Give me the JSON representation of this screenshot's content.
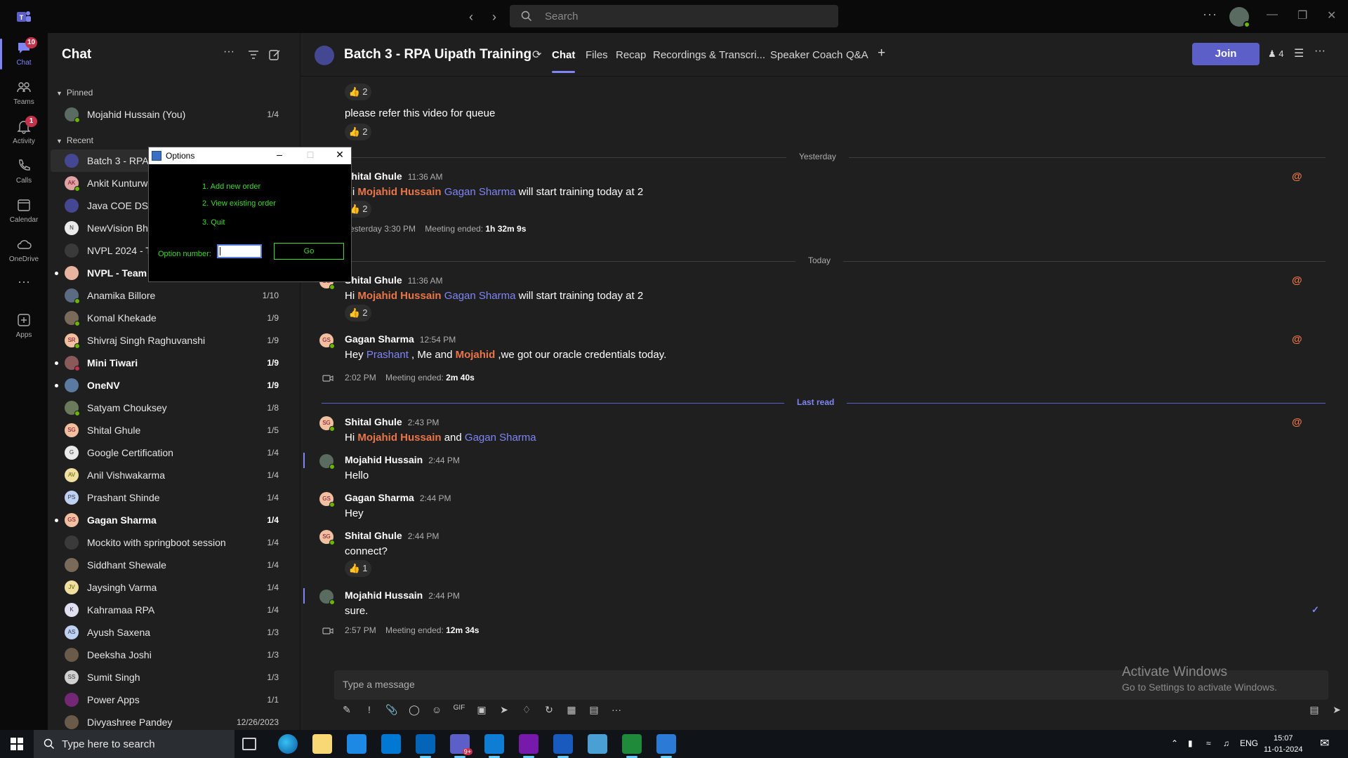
{
  "titlebar": {
    "search_placeholder": "Search"
  },
  "rail": {
    "items": [
      {
        "label": "Chat",
        "badge": "10"
      },
      {
        "label": "Teams"
      },
      {
        "label": "Activity",
        "badge": "1"
      },
      {
        "label": "Calls"
      },
      {
        "label": "Calendar"
      },
      {
        "label": "OneDrive"
      },
      {
        "label": "Apps"
      }
    ]
  },
  "chatlist": {
    "title": "Chat",
    "pinned_label": "Pinned",
    "recent_label": "Recent",
    "pinned": [
      {
        "name": "Mojahid Hussain (You)",
        "date": "1/4"
      }
    ],
    "items": [
      {
        "name": "Batch 3 - RPA Uipath Training",
        "date": ""
      },
      {
        "name": "Ankit Kunturwar",
        "date": ""
      },
      {
        "name": "Java COE DSM",
        "date": ""
      },
      {
        "name": "NewVision Bhopal",
        "date": ""
      },
      {
        "name": "NVPL 2024 - Team",
        "date": ""
      },
      {
        "name": "NVPL - Team Pune",
        "date": ""
      },
      {
        "name": "Anamika Billore",
        "date": "1/10"
      },
      {
        "name": "Komal Khekade",
        "date": "1/9"
      },
      {
        "name": "Shivraj Singh Raghuvanshi",
        "date": "1/9"
      },
      {
        "name": "Mini Tiwari",
        "date": "1/9"
      },
      {
        "name": "OneNV",
        "date": "1/9"
      },
      {
        "name": "Satyam Chouksey",
        "date": "1/8"
      },
      {
        "name": "Shital Ghule",
        "date": "1/5"
      },
      {
        "name": "Google Certification",
        "date": "1/4"
      },
      {
        "name": "Anil Vishwakarma",
        "date": "1/4"
      },
      {
        "name": "Prashant Shinde",
        "date": "1/4"
      },
      {
        "name": "Gagan Sharma",
        "date": "1/4"
      },
      {
        "name": "Mockito with springboot session",
        "date": "1/4"
      },
      {
        "name": "Siddhant Shewale",
        "date": "1/4"
      },
      {
        "name": "Jaysingh Varma",
        "date": "1/4"
      },
      {
        "name": "Kahramaa RPA",
        "date": "1/4"
      },
      {
        "name": "Ayush Saxena",
        "date": "1/3"
      },
      {
        "name": "Deeksha Joshi",
        "date": "1/3"
      },
      {
        "name": "Sumit Singh",
        "date": "1/3"
      },
      {
        "name": "Power Apps",
        "date": "1/1"
      },
      {
        "name": "Divyashree Pandey",
        "date": "12/26/2023"
      }
    ]
  },
  "header": {
    "title": "Batch 3 - RPA Uipath Training",
    "tabs": [
      "Chat",
      "Files",
      "Recap",
      "Recordings & Transcri...",
      "Speaker Coach",
      "Q&A"
    ],
    "join_label": "Join",
    "participants": "4"
  },
  "feed": {
    "reaction_2": "2",
    "reaction_1": "1",
    "queue_text": "please refer this video for queue",
    "divider_yesterday": "Yesterday",
    "divider_today": "Today",
    "divider_lastread": "Last read",
    "m1": {
      "sender": "Shital Ghule",
      "time": "11:36 AM",
      "pre": "Hi ",
      "m1": "Mojahid Hussain",
      "m2": "Gagan Sharma",
      "post": " will start training today  at 2"
    },
    "meeting1": {
      "time": "Yesterday 3:30 PM",
      "label": "Meeting ended: ",
      "dur": "1h 32m 9s"
    },
    "m2": {
      "sender": "Shital Ghule",
      "time": "11:36 AM",
      "pre": "Hi ",
      "m1": "Mojahid Hussain",
      "m2": "Gagan Sharma",
      "post": " will start training today  at 2"
    },
    "m3": {
      "sender": "Gagan Sharma",
      "time": "12:54 PM",
      "pre": "Hey ",
      "m1": "Prashant",
      "mid": " ,  Me and ",
      "m2": "Mojahid",
      "post": " ,we got our oracle credentials today."
    },
    "meeting2": {
      "time": "2:02 PM",
      "label": "Meeting ended: ",
      "dur": "2m 40s"
    },
    "m4": {
      "sender": "Shital Ghule",
      "time": "2:43 PM",
      "pre": "Hi ",
      "m1": "Mojahid Hussain",
      "mid": " and ",
      "m2": "Gagan Sharma"
    },
    "m5": {
      "sender": "Mojahid Hussain",
      "time": "2:44 PM",
      "text": "Hello"
    },
    "m6": {
      "sender": "Gagan Sharma",
      "time": "2:44 PM",
      "text": "Hey"
    },
    "m7": {
      "sender": "Shital Ghule",
      "time": "2:44 PM",
      "text": "connect?"
    },
    "m8": {
      "sender": "Mojahid Hussain",
      "time": "2:44 PM",
      "text": "sure."
    },
    "meeting3": {
      "time": "2:57 PM",
      "label": "Meeting ended: ",
      "dur": "12m 34s"
    }
  },
  "compose": {
    "placeholder": "Type a message"
  },
  "watermark": {
    "line1": "Activate Windows",
    "line2": "Go to Settings to activate Windows."
  },
  "dialog": {
    "title": "Options",
    "options": [
      "1. Add new order",
      "2. View existing order",
      "3. Quit"
    ],
    "input_label": "Option number:",
    "go_label": "Go"
  },
  "taskbar": {
    "search_placeholder": "Type here to search",
    "language": "ENG",
    "time": "15:07",
    "date": "11-01-2024",
    "teams_badge": "9+"
  }
}
